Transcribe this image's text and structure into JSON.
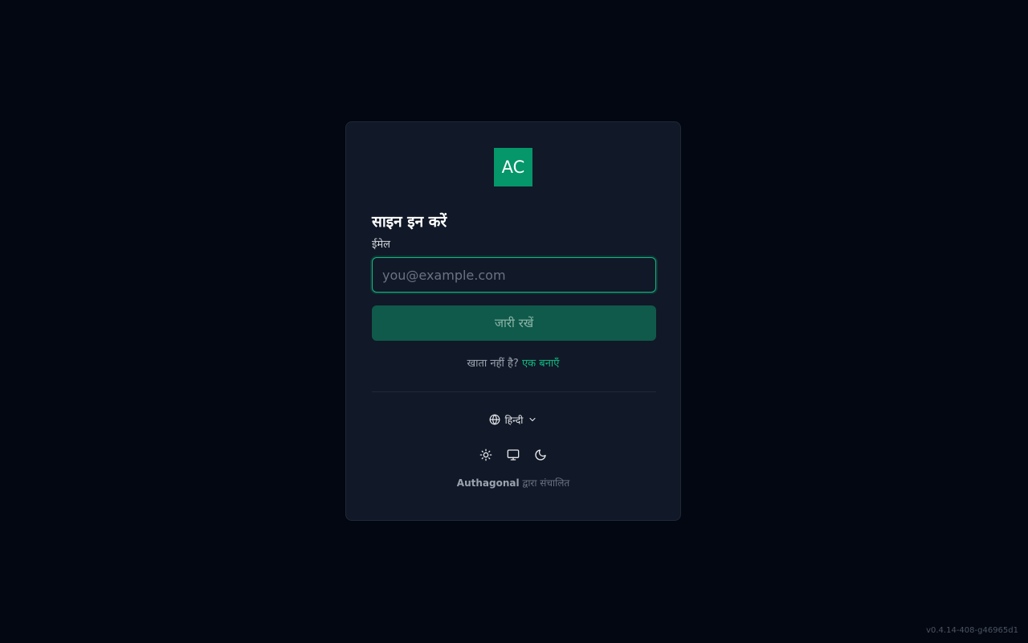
{
  "logo": {
    "text": "AC",
    "color": "#059669"
  },
  "form": {
    "title": "साइन इन करें",
    "email_label": "ईमेल",
    "email_placeholder": "you@example.com",
    "email_value": "",
    "continue_label": "जारी रखें"
  },
  "signup": {
    "prompt": "खाता नहीं है?",
    "link_label": "एक बनाएँ"
  },
  "language": {
    "icon": "globe-icon",
    "selected": "हिन्दी",
    "chevron_icon": "chevron-down-icon"
  },
  "theme": {
    "options": [
      {
        "name": "light",
        "icon": "sun-icon"
      },
      {
        "name": "system",
        "icon": "monitor-icon"
      },
      {
        "name": "dark",
        "icon": "moon-icon"
      }
    ]
  },
  "footer": {
    "brand": "Authagonal",
    "powered_suffix": "द्वारा संचालित"
  },
  "version": "v0.4.14-408-g46965d1",
  "colors": {
    "background": "#030712",
    "card": "#111827",
    "accent": "#10b981",
    "button": "#0f5a4a"
  }
}
